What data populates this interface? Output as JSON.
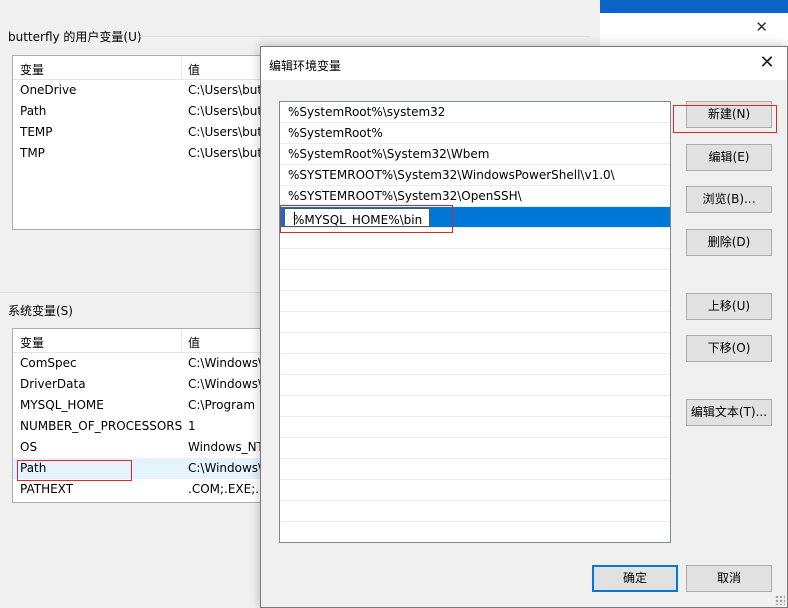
{
  "user_vars": {
    "group_title": "butterfly 的用户变量(U)",
    "columns": [
      "变量",
      "值"
    ],
    "rows": [
      {
        "name": "OneDrive",
        "value": "C:\\Users\\but"
      },
      {
        "name": "Path",
        "value": "C:\\Users\\but"
      },
      {
        "name": "TEMP",
        "value": "C:\\Users\\but"
      },
      {
        "name": "TMP",
        "value": "C:\\Users\\but"
      }
    ]
  },
  "system_vars": {
    "group_title": "系统变量(S)",
    "columns": [
      "变量",
      "值"
    ],
    "rows": [
      {
        "name": "ComSpec",
        "value": "C:\\Windows\\"
      },
      {
        "name": "DriverData",
        "value": "C:\\Windows\\"
      },
      {
        "name": "MYSQL_HOME",
        "value": "C:\\Program"
      },
      {
        "name": "NUMBER_OF_PROCESSORS",
        "value": "1"
      },
      {
        "name": "OS",
        "value": "Windows_NT"
      },
      {
        "name": "Path",
        "value": "C:\\Windows\\"
      },
      {
        "name": "PATHEXT",
        "value": ".COM;.EXE;.E"
      }
    ]
  },
  "dialog": {
    "title": "编辑环境变量",
    "close_glyph": "✕",
    "entries": [
      "%SystemRoot%\\system32",
      "%SystemRoot%",
      "%SystemRoot%\\System32\\Wbem",
      "%SYSTEMROOT%\\System32\\WindowsPowerShell\\v1.0\\",
      "%SYSTEMROOT%\\System32\\OpenSSH\\"
    ],
    "editing_value": "%MYSQL_HOME%\\bin",
    "buttons": {
      "new": "新建(N)",
      "edit": "编辑(E)",
      "browse": "浏览(B)...",
      "delete": "删除(D)",
      "move_up": "上移(U)",
      "move_down": "下移(O)",
      "edit_text": "编辑文本(T)...",
      "ok": "确定",
      "cancel": "取消"
    }
  },
  "background_close_glyph": "✕",
  "colors": {
    "selection": "#0078d7",
    "highlight_box": "#e0262a",
    "row_hover": "#e5f3ff"
  }
}
